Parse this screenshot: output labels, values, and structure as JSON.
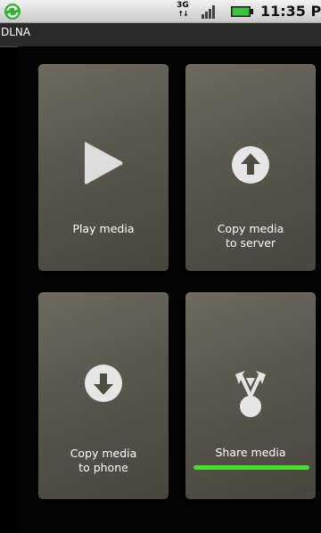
{
  "status_bar": {
    "network_type": "3G",
    "network_arrows": "↑↓",
    "time": "11:35 PM",
    "icons": [
      "sync-icon",
      "network-3g-icon",
      "signal-icon",
      "battery-icon"
    ],
    "colors": {
      "sync": "#2fb52f",
      "battery": "#39c23a"
    }
  },
  "title_bar": {
    "title": "DLNA"
  },
  "tiles": [
    {
      "label": "Play media",
      "icon": "play-icon"
    },
    {
      "label": "Copy media\nto server",
      "icon": "upload-icon"
    },
    {
      "label": "Copy media\nto phone",
      "icon": "download-icon"
    },
    {
      "label": "Share media",
      "icon": "share-icon",
      "focused": true
    }
  ],
  "colors": {
    "tile": "#5f5d52",
    "focus": "#54d63a",
    "icon_fill": "#e6e6e6"
  }
}
